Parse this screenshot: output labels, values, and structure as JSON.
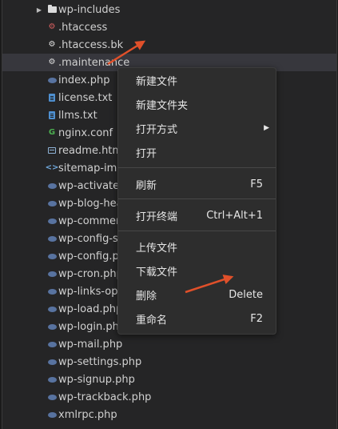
{
  "file_tree": {
    "items": [
      {
        "label": "wp-includes",
        "icon": "folder-icon",
        "expandable": true
      },
      {
        "label": ".htaccess",
        "icon": "gear-red-icon"
      },
      {
        "label": ".htaccess.bk",
        "icon": "gear-icon"
      },
      {
        "label": ".maintenance",
        "icon": "gear-icon",
        "selected": true
      },
      {
        "label": "index.php",
        "icon": "php-icon"
      },
      {
        "label": "license.txt",
        "icon": "text-file-icon"
      },
      {
        "label": "llms.txt",
        "icon": "text-file-icon"
      },
      {
        "label": "nginx.conf",
        "icon": "nginx-icon"
      },
      {
        "label": "readme.html",
        "icon": "html-icon"
      },
      {
        "label": "sitemap-imag",
        "icon": "xml-icon"
      },
      {
        "label": "wp-activate.p",
        "icon": "php-icon"
      },
      {
        "label": "wp-blog-hea",
        "icon": "php-icon"
      },
      {
        "label": "wp-comment",
        "icon": "php-icon"
      },
      {
        "label": "wp-config-sa",
        "icon": "php-icon"
      },
      {
        "label": "wp-config.ph",
        "icon": "php-icon"
      },
      {
        "label": "wp-cron.php",
        "icon": "php-icon"
      },
      {
        "label": "wp-links-opm",
        "icon": "php-icon"
      },
      {
        "label": "wp-load.php",
        "icon": "php-icon"
      },
      {
        "label": "wp-login.php",
        "icon": "php-icon"
      },
      {
        "label": "wp-mail.php",
        "icon": "php-icon"
      },
      {
        "label": "wp-settings.php",
        "icon": "php-icon"
      },
      {
        "label": "wp-signup.php",
        "icon": "php-icon"
      },
      {
        "label": "wp-trackback.php",
        "icon": "php-icon"
      },
      {
        "label": "xmlrpc.php",
        "icon": "php-icon"
      }
    ]
  },
  "context_menu": {
    "new_file": "新建文件",
    "new_folder": "新建文件夹",
    "open_with": "打开方式",
    "open": "打开",
    "refresh": "刷新",
    "refresh_shortcut": "F5",
    "open_terminal": "打开终端",
    "open_terminal_shortcut": "Ctrl+Alt+1",
    "upload_file": "上传文件",
    "download_file": "下载文件",
    "delete": "删除",
    "delete_shortcut": "Delete",
    "rename": "重命名",
    "rename_shortcut": "F2"
  },
  "colors": {
    "annotation_arrow": "#e0502a",
    "panel_bg": "#252526",
    "menu_bg": "#2d2d2d",
    "selected_row": "#37373d"
  }
}
